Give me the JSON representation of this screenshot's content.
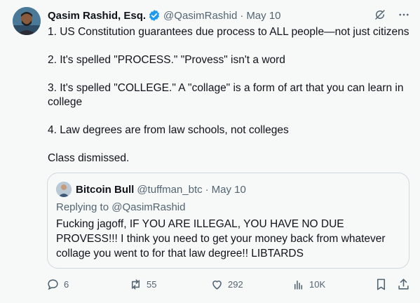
{
  "author": {
    "name": "Qasim Rashid, Esq.",
    "handle": "@QasimRashid",
    "separator": "·",
    "date": "May 10",
    "verified_color": "#1d9bf0"
  },
  "top_icons": [
    "grok-icon",
    "more-icon"
  ],
  "tweet": {
    "paragraphs": [
      "1. US Constitution guarantees due process to ALL people—not just citizens",
      "2. It's spelled \"PROCESS.\" \"Provess\" isn't a word",
      "3. It's spelled \"COLLEGE.\" A \"collage\" is a form of art that you can learn in college",
      "4. Law degrees are from law schools, not colleges",
      "Class dismissed."
    ]
  },
  "quoted": {
    "name": "Bitcoin Bull",
    "handle": "@tuffman_btc",
    "separator": "·",
    "date": "May 10",
    "replying_to": "Replying to @QasimRashid",
    "text": "Fucking jagoff, IF YOU ARE ILLEGAL, YOU HAVE NO DUE PROVESS!!! I think you need to get your money back from whatever collage you went to for that law degree!! LIBTARDS"
  },
  "actions": {
    "replies": "6",
    "reposts": "55",
    "likes": "292",
    "views": "10K"
  },
  "colors": {
    "text": "#0f1419",
    "secondary": "#536471",
    "border": "#cfd9de",
    "background": "#f7f9f9"
  }
}
